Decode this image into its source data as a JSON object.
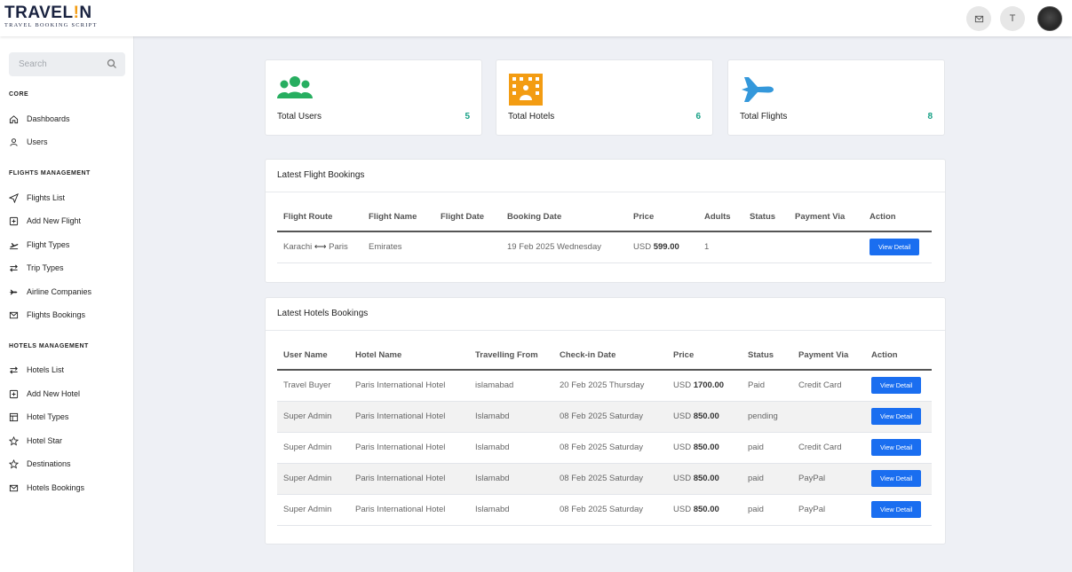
{
  "brand": {
    "logo_prefix": "TRAVEL",
    "logo_mid": "!",
    "logo_suffix": "N",
    "tagline": "TRAVEL BOOKING SCRIPT"
  },
  "topbar": {
    "user_initial": "T"
  },
  "sidebar": {
    "search_placeholder": "Search",
    "sections": [
      {
        "title": "CORE"
      },
      {
        "title": "FLIGHTS MANAGEMENT"
      },
      {
        "title": "HOTELS MANAGEMENT"
      }
    ],
    "items": [
      {
        "label": "Dashboards",
        "icon": "home-icon"
      },
      {
        "label": "Users",
        "icon": "user-icon"
      },
      {
        "label": "Flights List",
        "icon": "send-icon"
      },
      {
        "label": "Add New Flight",
        "icon": "plus-square-icon"
      },
      {
        "label": "Flight Types",
        "icon": "plane-departure-icon"
      },
      {
        "label": "Trip Types",
        "icon": "swap-icon"
      },
      {
        "label": "Airline Companies",
        "icon": "plane-icon"
      },
      {
        "label": "Flights Bookings",
        "icon": "mail-icon"
      },
      {
        "label": "Hotels List",
        "icon": "swap-icon"
      },
      {
        "label": "Add New Hotel",
        "icon": "plus-square-icon"
      },
      {
        "label": "Hotel Types",
        "icon": "layout-icon"
      },
      {
        "label": "Hotel Star",
        "icon": "star-icon"
      },
      {
        "label": "Destinations",
        "icon": "star-icon"
      },
      {
        "label": "Hotels Bookings",
        "icon": "mail-icon"
      }
    ]
  },
  "stats": [
    {
      "label": "Total Users",
      "value": "5",
      "icon": "users-icon",
      "color": "#27ae60"
    },
    {
      "label": "Total Hotels",
      "value": "6",
      "icon": "hotel-icon",
      "color": "#f39c12"
    },
    {
      "label": "Total Flights",
      "value": "8",
      "icon": "plane-icon",
      "color": "#3498db"
    }
  ],
  "flight_bookings": {
    "title": "Latest Flight Bookings",
    "headers": [
      "Flight Route",
      "Flight Name",
      "Flight Date",
      "Booking Date",
      "Price",
      "Adults",
      "Status",
      "Payment Via",
      "Action"
    ],
    "rows": [
      {
        "from": "Karachi",
        "to": "Paris",
        "name": "Emirates",
        "flight_date": "",
        "booking_date": "19 Feb 2025 Wednesday",
        "currency": "USD",
        "price": "599.00",
        "adults": "1",
        "status": "",
        "payment": "",
        "action": "View Detail"
      }
    ]
  },
  "hotel_bookings": {
    "title": "Latest Hotels Bookings",
    "headers": [
      "User Name",
      "Hotel Name",
      "Travelling From",
      "Check-in Date",
      "Price",
      "Status",
      "Payment Via",
      "Action"
    ],
    "rows": [
      {
        "user": "Travel Buyer",
        "hotel": "Paris International Hotel",
        "from": "islamabad",
        "checkin": "20 Feb 2025 Thursday",
        "currency": "USD",
        "price": "1700.00",
        "status": "Paid",
        "payment": "Credit Card",
        "action": "View Detail"
      },
      {
        "user": "Super Admin",
        "hotel": "Paris International Hotel",
        "from": "Islamabd",
        "checkin": "08 Feb 2025 Saturday",
        "currency": "USD",
        "price": "850.00",
        "status": "pending",
        "payment": "",
        "action": "View Detail"
      },
      {
        "user": "Super Admin",
        "hotel": "Paris International Hotel",
        "from": "Islamabd",
        "checkin": "08 Feb 2025 Saturday",
        "currency": "USD",
        "price": "850.00",
        "status": "paid",
        "payment": "Credit Card",
        "action": "View Detail"
      },
      {
        "user": "Super Admin",
        "hotel": "Paris International Hotel",
        "from": "Islamabd",
        "checkin": "08 Feb 2025 Saturday",
        "currency": "USD",
        "price": "850.00",
        "status": "paid",
        "payment": "PayPal",
        "action": "View Detail"
      },
      {
        "user": "Super Admin",
        "hotel": "Paris International Hotel",
        "from": "Islamabd",
        "checkin": "08 Feb 2025 Saturday",
        "currency": "USD",
        "price": "850.00",
        "status": "paid",
        "payment": "PayPal",
        "action": "View Detail"
      }
    ]
  }
}
